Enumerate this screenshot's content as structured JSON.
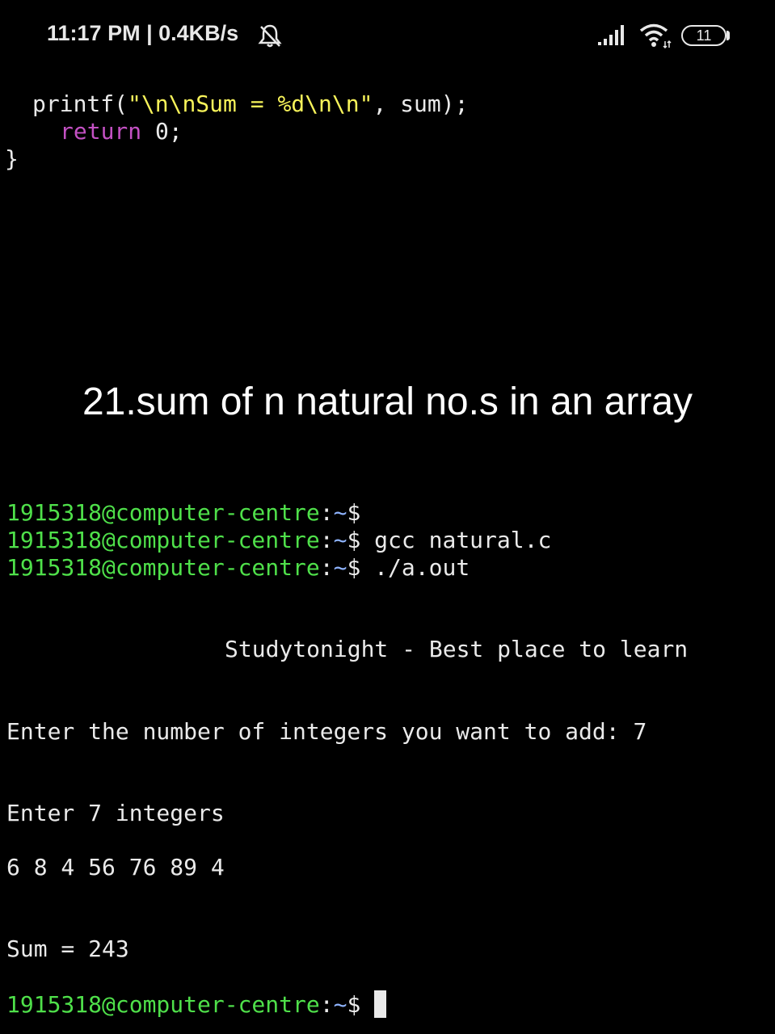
{
  "status_bar": {
    "time": "11:17 PM | 0.4KB/s",
    "battery": "11",
    "icons": [
      "bell-muted-icon",
      "cellular-signal-icon",
      "wifi-icon",
      "battery-icon"
    ]
  },
  "code": {
    "line1_func": "printf(",
    "line1_string": "\"\\n\\nSum = %d\\n\\n\"",
    "line1_rest": ", sum);",
    "line2_keyword": "return",
    "line2_rest": " 0;",
    "line3": "}"
  },
  "caption": "21.sum of n natural no.s in an array",
  "terminal": {
    "prompt_user": "1915318@computer-centre",
    "prompt_colon": ":",
    "prompt_path": "~",
    "prompt_dollar": "$",
    "commands": [
      "",
      " gcc natural.c",
      " ./a.out"
    ],
    "banner": "Studytonight - Best place to learn",
    "ask_count": "Enter the number of integers you want to add: 7",
    "ask_integers": "Enter 7 integers",
    "input_values": "6 8 4 56 76 89 4",
    "result": "Sum = 243"
  },
  "colors": {
    "prompt_green": "#4fe04a",
    "path_blue": "#8fb4ff",
    "string_yellow": "#f7f35a",
    "keyword_purple": "#c451c4",
    "background": "#000000"
  }
}
